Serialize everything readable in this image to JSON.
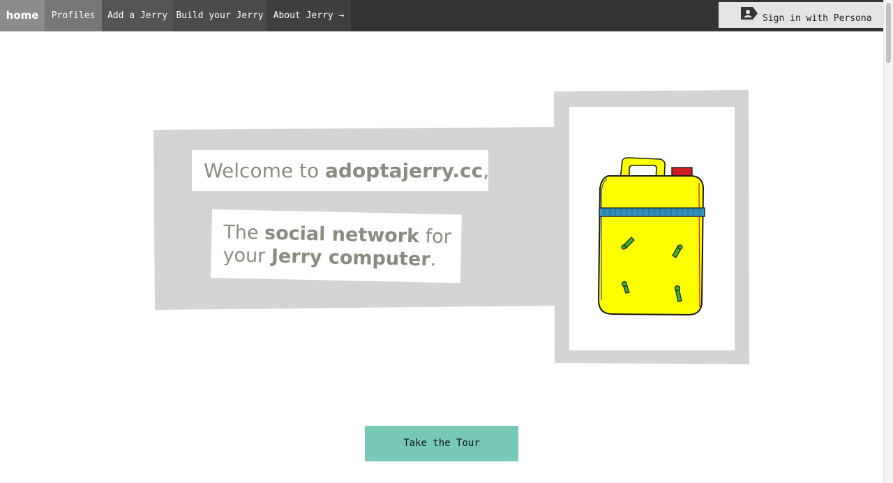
{
  "nav": {
    "home": "home",
    "profiles": "Profiles",
    "add": "Add a Jerry",
    "build": "Build your Jerry",
    "about": "About Jerry →"
  },
  "signin": {
    "label": "Sign in with Persona",
    "icon": "persona-icon"
  },
  "hero": {
    "line1_prefix": "Welcome to ",
    "line1_site": "adoptajerry.cc",
    "line1_suffix": ",",
    "line2_a": "The ",
    "line2_b": "social network",
    "line2_c": " for",
    "line3_a": "your ",
    "line3_b": "Jerry computer",
    "line3_c": ".",
    "illustration": "jerry-can-icon"
  },
  "cta": {
    "label": "Take the Tour"
  },
  "colors": {
    "topbar": "#333333",
    "panel": "#d4d4d4",
    "headline_text": "#8b8b80",
    "jerry_can": "#ffff00",
    "cta": "#78c8b8"
  }
}
